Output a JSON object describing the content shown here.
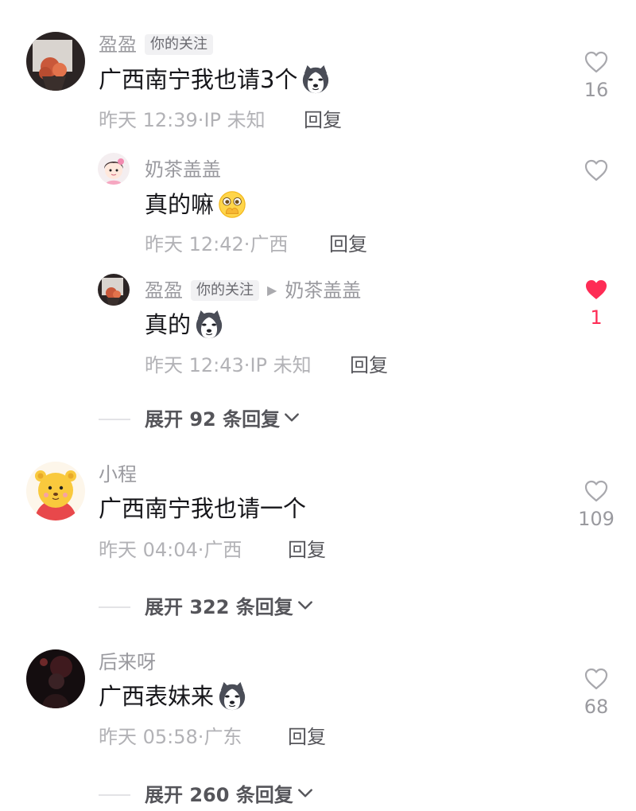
{
  "comments": [
    {
      "username": "盈盈",
      "tag": "你的关注",
      "text": "广西南宁我也请3个",
      "time": "昨天 12:39",
      "location": "IP 未知",
      "reply_label": "回复",
      "likes": "16",
      "replies": [
        {
          "username": "奶茶盖盖",
          "text": "真的嘛",
          "time": "昨天 12:42",
          "location": "广西",
          "reply_label": "回复"
        },
        {
          "username": "盈盈",
          "tag": "你的关注",
          "reply_to": "奶茶盖盖",
          "text": "真的",
          "time": "昨天 12:43",
          "location": "IP 未知",
          "reply_label": "回复",
          "likes": "1",
          "liked": true
        }
      ],
      "expand_label": "展开 92 条回复"
    },
    {
      "username": "小程",
      "text": "广西南宁我也请一个",
      "time": "昨天 04:04",
      "location": "广西",
      "reply_label": "回复",
      "likes": "109",
      "expand_label": "展开 322 条回复"
    },
    {
      "username": "后来呀",
      "text": "广西表妹来",
      "time": "昨天 05:58",
      "location": "广东",
      "reply_label": "回复",
      "likes": "68",
      "expand_label": "展开 260 条回复"
    }
  ],
  "colors": {
    "liked": "#fe2c55",
    "secondary_text": "#9a9a9f",
    "primary_text": "#16161a"
  },
  "icons": [
    "heart-outline-icon",
    "heart-filled-icon",
    "chevron-down-icon",
    "husky-emoji",
    "shy-face-emoji",
    "reply-arrow-icon"
  ]
}
